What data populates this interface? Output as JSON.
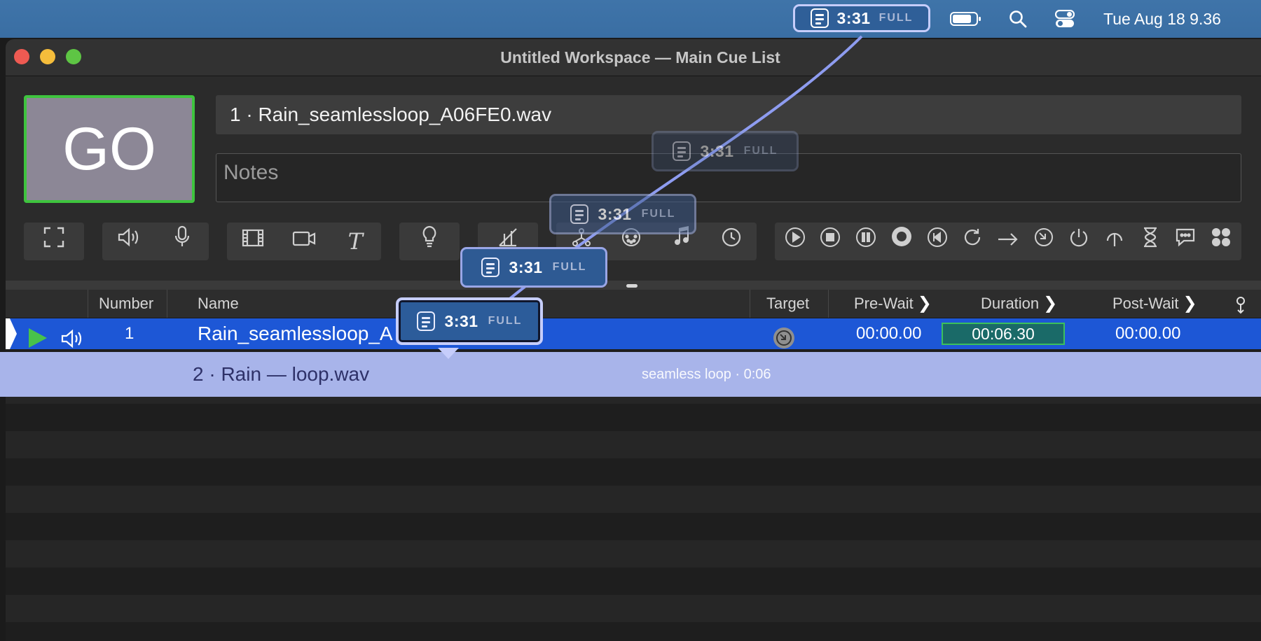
{
  "menubar": {
    "now_playing": {
      "time": "3:31",
      "tag": "FULL"
    },
    "datetime": "Tue Aug 18  9.36",
    "icons": [
      "battery-icon",
      "search-icon",
      "control-center-icon"
    ]
  },
  "window": {
    "title": "Untitled Workspace — Main Cue List",
    "traffic_lights": {
      "close": "#ee5a52",
      "minimize": "#f5bd3b",
      "zoom": "#5ec544"
    }
  },
  "go": {
    "label": "GO",
    "border_color": "#3ec43e"
  },
  "cue_name": "1 · Rain_seamlessloop_A06FE0.wav",
  "notes": {
    "placeholder": "Notes"
  },
  "toolbar": {
    "groups": [
      [
        "fullscreen-icon"
      ],
      [
        "speaker-icon",
        "microphone-icon"
      ],
      [
        "film-icon",
        "camera-icon",
        "text-icon"
      ],
      [
        "light-icon"
      ],
      [
        "fade-icon"
      ],
      [
        "network-icon",
        "midi-icon",
        "music-icon",
        "clock-icon"
      ],
      [
        "play-icon",
        "stop-icon",
        "pause-icon",
        "load-icon",
        "reset-icon",
        "loop-icon",
        "goto-icon",
        "target-icon",
        "power-icon",
        "arm-icon",
        "wait-icon",
        "memo-icon",
        "group-icon"
      ]
    ]
  },
  "table": {
    "headers": {
      "number": "Number",
      "name": "Name",
      "target": "Target",
      "pre_wait": "Pre-Wait",
      "duration": "Duration",
      "post_wait": "Post-Wait"
    },
    "rows": [
      {
        "number": "1",
        "name": "Rain_seamlessloop_A",
        "pre_wait": "00:00.00",
        "duration": "00:06.30",
        "post_wait": "00:00.00"
      }
    ]
  },
  "drag_ghost": {
    "name": "2 · Rain — loop.wav",
    "meta": "seamless loop · 0:06"
  },
  "floating_pills": [
    {
      "time": "3:31",
      "tag": "FULL"
    },
    {
      "time": "3:31",
      "tag": "FULL"
    },
    {
      "time": "3:31",
      "tag": "FULL"
    },
    {
      "time": "3:31",
      "tag": "FULL"
    }
  ],
  "colors": {
    "selection": "#1d57d6",
    "ghost_row": "#a8b4ea",
    "pill_border": "#c6cdfb",
    "trail": "#8e9cf0"
  }
}
